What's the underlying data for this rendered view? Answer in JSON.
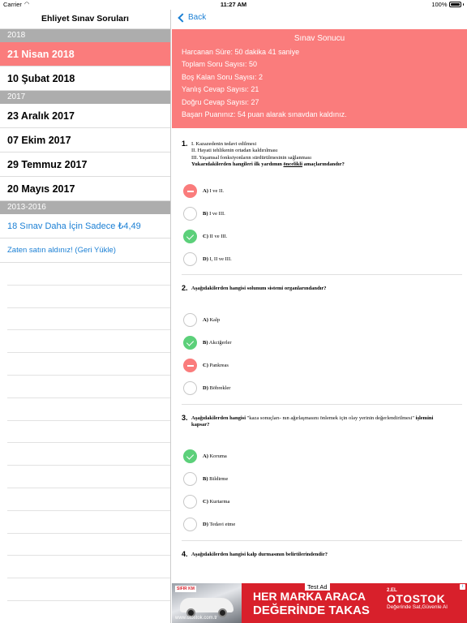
{
  "status": {
    "carrier": "Carrier",
    "time": "11:27 AM",
    "battery": "100%",
    "battery_level": 1.0
  },
  "sidebar": {
    "title": "Ehliyet Sınav Soruları",
    "sections": [
      {
        "header": "2018",
        "items": [
          "21 Nisan 2018",
          "10 Şubat 2018"
        ]
      },
      {
        "header": "2017",
        "items": [
          "23 Aralık 2017",
          "07 Ekim 2017",
          "29 Temmuz 2017",
          "20 Mayıs 2017"
        ]
      },
      {
        "header": "2013-2016",
        "items": [
          "18 Sınav Daha İçin Sadece ₺4,49",
          "Zaten satın aldınız! (Geri Yükle)"
        ]
      }
    ]
  },
  "nav": {
    "back_label": "Back"
  },
  "result": {
    "title": "Sınav Sonucu",
    "lines": [
      "Harcanan Süre:  50 dakika 41 saniye",
      "Toplam Soru Sayısı:  50",
      "Boş Kalan Soru Sayısı:  2",
      "Yanlış Cevap Sayısı:  21",
      "Doğru Cevap Sayısı:  27",
      "Başarı Puanınız:  54 puan alarak sınavdan kaldınız."
    ]
  },
  "questions": [
    {
      "number": "1.",
      "lines": [
        "I. Kazazedenin tedavi edilmesi",
        "II. Hayati tehlikenin ortadan kaldırılması",
        "III. Yaşamsal fonksiyonların sürdürülmesinin sağlanması"
      ],
      "prompt_a": "Yukarıdakilerden hangileri ilk yardımın ",
      "prompt_u": "öncelikli",
      "prompt_b": " amaçlarındandır?",
      "options": [
        {
          "letter": "A)",
          "text": "I ve II.",
          "state": "wrong"
        },
        {
          "letter": "B)",
          "text": "I ve III.",
          "state": "none"
        },
        {
          "letter": "C)",
          "text": "II ve III.",
          "state": "correct"
        },
        {
          "letter": "D)",
          "text": "I, II ve III.",
          "state": "none"
        }
      ]
    },
    {
      "number": "2.",
      "prompt": "Aşağıdakilerden hangisi solunum sistemi organlarındandır?",
      "options": [
        {
          "letter": "A)",
          "text": "Kalp",
          "state": "none"
        },
        {
          "letter": "B)",
          "text": "Akciğerler",
          "state": "correct"
        },
        {
          "letter": "C)",
          "text": "Pankreas",
          "state": "wrong"
        },
        {
          "letter": "D)",
          "text": "Böbrekler",
          "state": "none"
        }
      ]
    },
    {
      "number": "3.",
      "prompt_a": "Aşağıdakilerden hangisi",
      "prompt_q": " \"kaza sonuçları- nın ağırlaşmasını önlemek için olay yerinin değerlendirilmesi\" ",
      "prompt_b": "işlemini kapsar?",
      "options": [
        {
          "letter": "A)",
          "text": "Koruma",
          "state": "correct"
        },
        {
          "letter": "B)",
          "text": "Bildirme",
          "state": "none"
        },
        {
          "letter": "C)",
          "text": "Kurtarma",
          "state": "none"
        },
        {
          "letter": "D)",
          "text": "Tedavi etme",
          "state": "none"
        }
      ]
    },
    {
      "number": "4.",
      "prompt": "Aşağıdakilerden hangisi kalp durmasının belirtilerindendir?"
    }
  ],
  "ad": {
    "test_label": "Test Ad",
    "line1": "HER MARKA ARACA",
    "line2": "DEĞERİNDE TAKAS",
    "tag": "2.EL",
    "brand": "OTOSTOK",
    "slogan": "Değerinde Sat,Güvenle Al",
    "url": "www.otostok.com.tr",
    "badge": "SIFIR KM",
    "info": "i"
  },
  "colors": {
    "accent": "#fa7c7c",
    "correct": "#5cd07a",
    "link": "#1a7fd4",
    "section": "#adadad",
    "ad": "#d8202b"
  }
}
